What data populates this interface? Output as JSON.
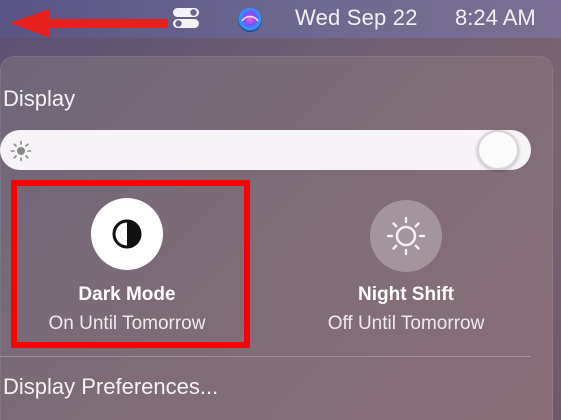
{
  "menubar": {
    "date": "Wed Sep 22",
    "time": "8:24 AM",
    "icons": [
      "control-center-icon",
      "siri-icon"
    ],
    "annotation_arrow_color": "#e8201e"
  },
  "display_panel": {
    "title": "Display",
    "brightness": {
      "level": 1.0,
      "icon": "sun-icon"
    },
    "tiles": [
      {
        "title": "Dark Mode",
        "subtitle": "On Until Tomorrow",
        "icon": "dark-mode-icon",
        "active": true,
        "highlighted": true
      },
      {
        "title": "Night Shift",
        "subtitle": "Off Until Tomorrow",
        "icon": "night-shift-icon",
        "active": false
      }
    ],
    "preferences_link": "Display Preferences..."
  },
  "colors": {
    "highlight_box": "#ff0000",
    "slider_track": "#f6f4f6",
    "active_tile_bg": "#ffffff"
  }
}
